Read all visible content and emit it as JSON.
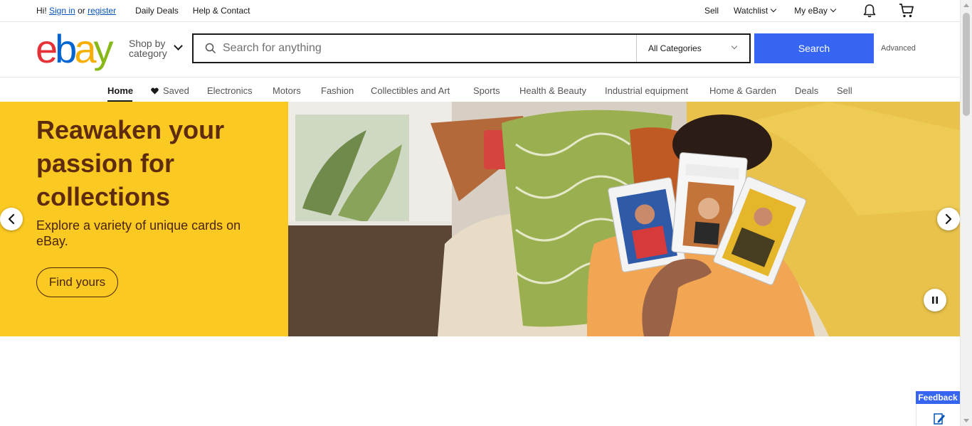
{
  "topbar": {
    "greeting": "Hi!",
    "sign_in": "Sign in",
    "or": "or",
    "register": "register",
    "daily_deals": "Daily Deals",
    "help_contact": "Help & Contact",
    "sell": "Sell",
    "watchlist": "Watchlist",
    "my_ebay": "My eBay",
    "icons": [
      "bell-icon",
      "cart-icon"
    ]
  },
  "header": {
    "logo_letters": [
      "e",
      "b",
      "a",
      "y"
    ],
    "logo_colors": [
      "#e53238",
      "#0064d2",
      "#f5af02",
      "#86b817"
    ],
    "shop_by_line1": "Shop by",
    "shop_by_line2": "category",
    "search_placeholder": "Search for anything",
    "search_value": "",
    "category_selected": "All Categories",
    "search_button": "Search",
    "advanced": "Advanced"
  },
  "nav": {
    "items": [
      "Home",
      "Saved",
      "Electronics",
      "Motors",
      "Fashion",
      "Collectibles and Art",
      "Sports",
      "Health & Beauty",
      "Industrial equipment",
      "Home & Garden",
      "Deals",
      "Sell"
    ],
    "active": "Home"
  },
  "hero": {
    "headline": "Reawaken your passion for collections",
    "subtext": "Explore a variety of unique cards on eBay.",
    "cta": "Find yours",
    "panel_color": "#fbca22"
  },
  "feedback": {
    "label": "Feedback"
  }
}
